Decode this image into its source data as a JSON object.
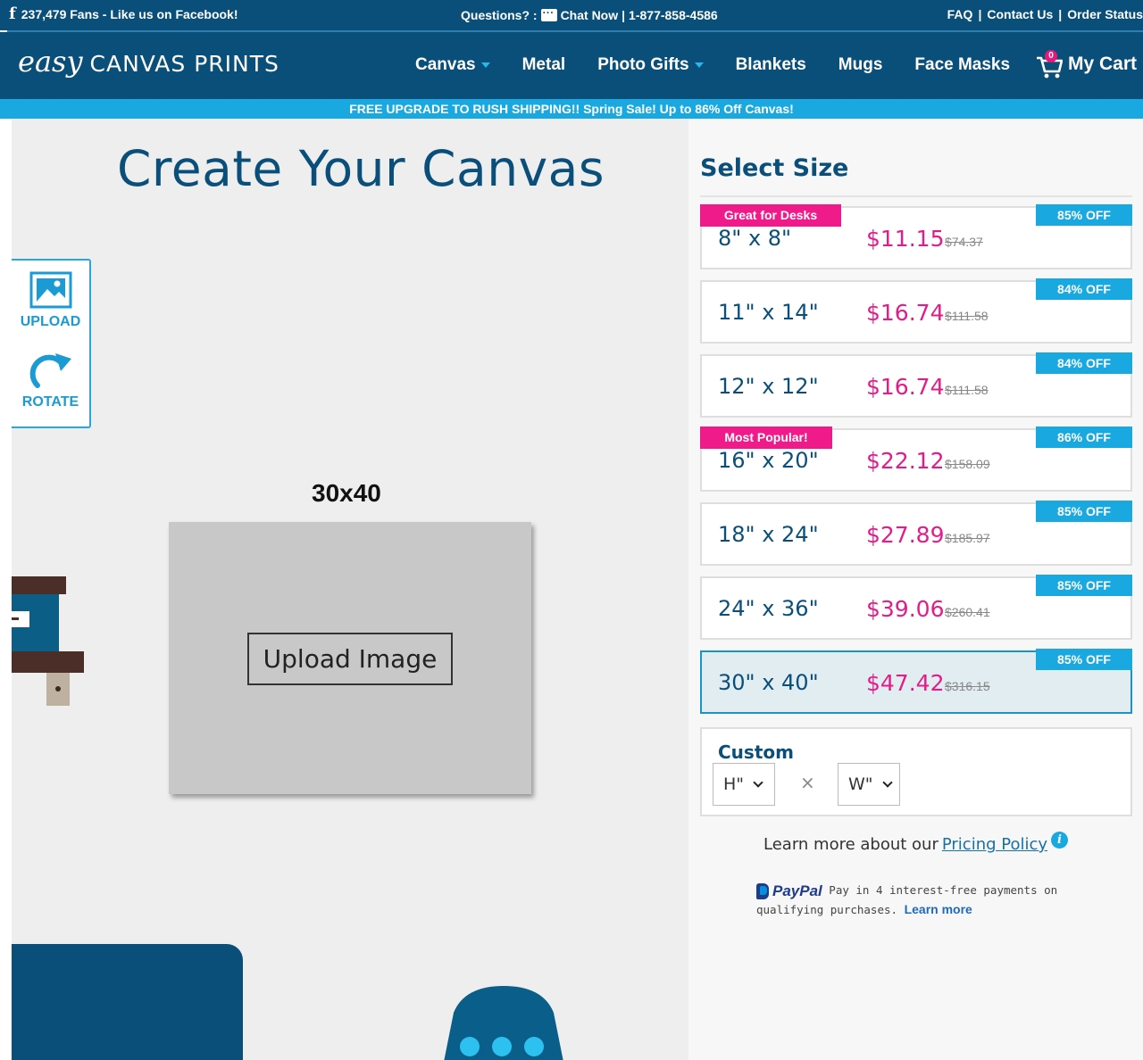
{
  "topbar": {
    "fans": "237,479 Fans - Like us on Facebook!",
    "questions": "Questions? :",
    "chat_now": "Chat Now",
    "sep": "|",
    "phone": "1-877-858-4586",
    "links": [
      "FAQ",
      "|",
      "Contact Us",
      "|",
      "Order Status"
    ]
  },
  "nav": {
    "logo_easy": "easy",
    "logo_rest": "CANVAS PRINTS",
    "items": [
      "Canvas",
      "Metal",
      "Photo Gifts",
      "Blankets",
      "Mugs",
      "Face Masks"
    ],
    "cart_label": "My Cart",
    "cart_count": "0"
  },
  "promo": "FREE UPGRADE TO RUSH SHIPPING!! Spring Sale! Up to 86% Off Canvas!",
  "main": {
    "title": "Create Your Canvas",
    "upload_label": "UPLOAD",
    "rotate_label": "ROTATE",
    "size_label": "30x40",
    "upload_button": "Upload Image"
  },
  "panel": {
    "title": "Select Size",
    "sizes": [
      {
        "dim": "8\" x 8\"",
        "price": "$11.15",
        "orig": "$74.37",
        "off": "85% OFF",
        "tag": "Great for Desks"
      },
      {
        "dim": "11\" x 14\"",
        "price": "$16.74",
        "orig": "$111.58",
        "off": "84% OFF",
        "tag": ""
      },
      {
        "dim": "12\" x 12\"",
        "price": "$16.74",
        "orig": "$111.58",
        "off": "84% OFF",
        "tag": ""
      },
      {
        "dim": "16\" x 20\"",
        "price": "$22.12",
        "orig": "$158.09",
        "off": "86% OFF",
        "tag": "Most Popular!"
      },
      {
        "dim": "18\" x 24\"",
        "price": "$27.89",
        "orig": "$185.97",
        "off": "85% OFF",
        "tag": ""
      },
      {
        "dim": "24\" x 36\"",
        "price": "$39.06",
        "orig": "$260.41",
        "off": "85% OFF",
        "tag": ""
      },
      {
        "dim": "30\" x 40\"",
        "price": "$47.42",
        "orig": "$316.15",
        "off": "85% OFF",
        "tag": "",
        "selected": true
      }
    ],
    "custom": {
      "label": "Custom",
      "h_value": "H\"",
      "w_value": "W\"",
      "x": "×"
    },
    "pricing_prefix": "Learn more about our",
    "pricing_link": "Pricing Policy",
    "info_glyph": "i",
    "paypal_brand": "PayPal",
    "paypal_text": "Pay in 4 interest-free payments on qualifying purchases.",
    "paypal_learn": "Learn more"
  },
  "colors": {
    "navy": "#0a4f7a",
    "accent_blue": "#19a9e0",
    "pink": "#e21d8a"
  }
}
